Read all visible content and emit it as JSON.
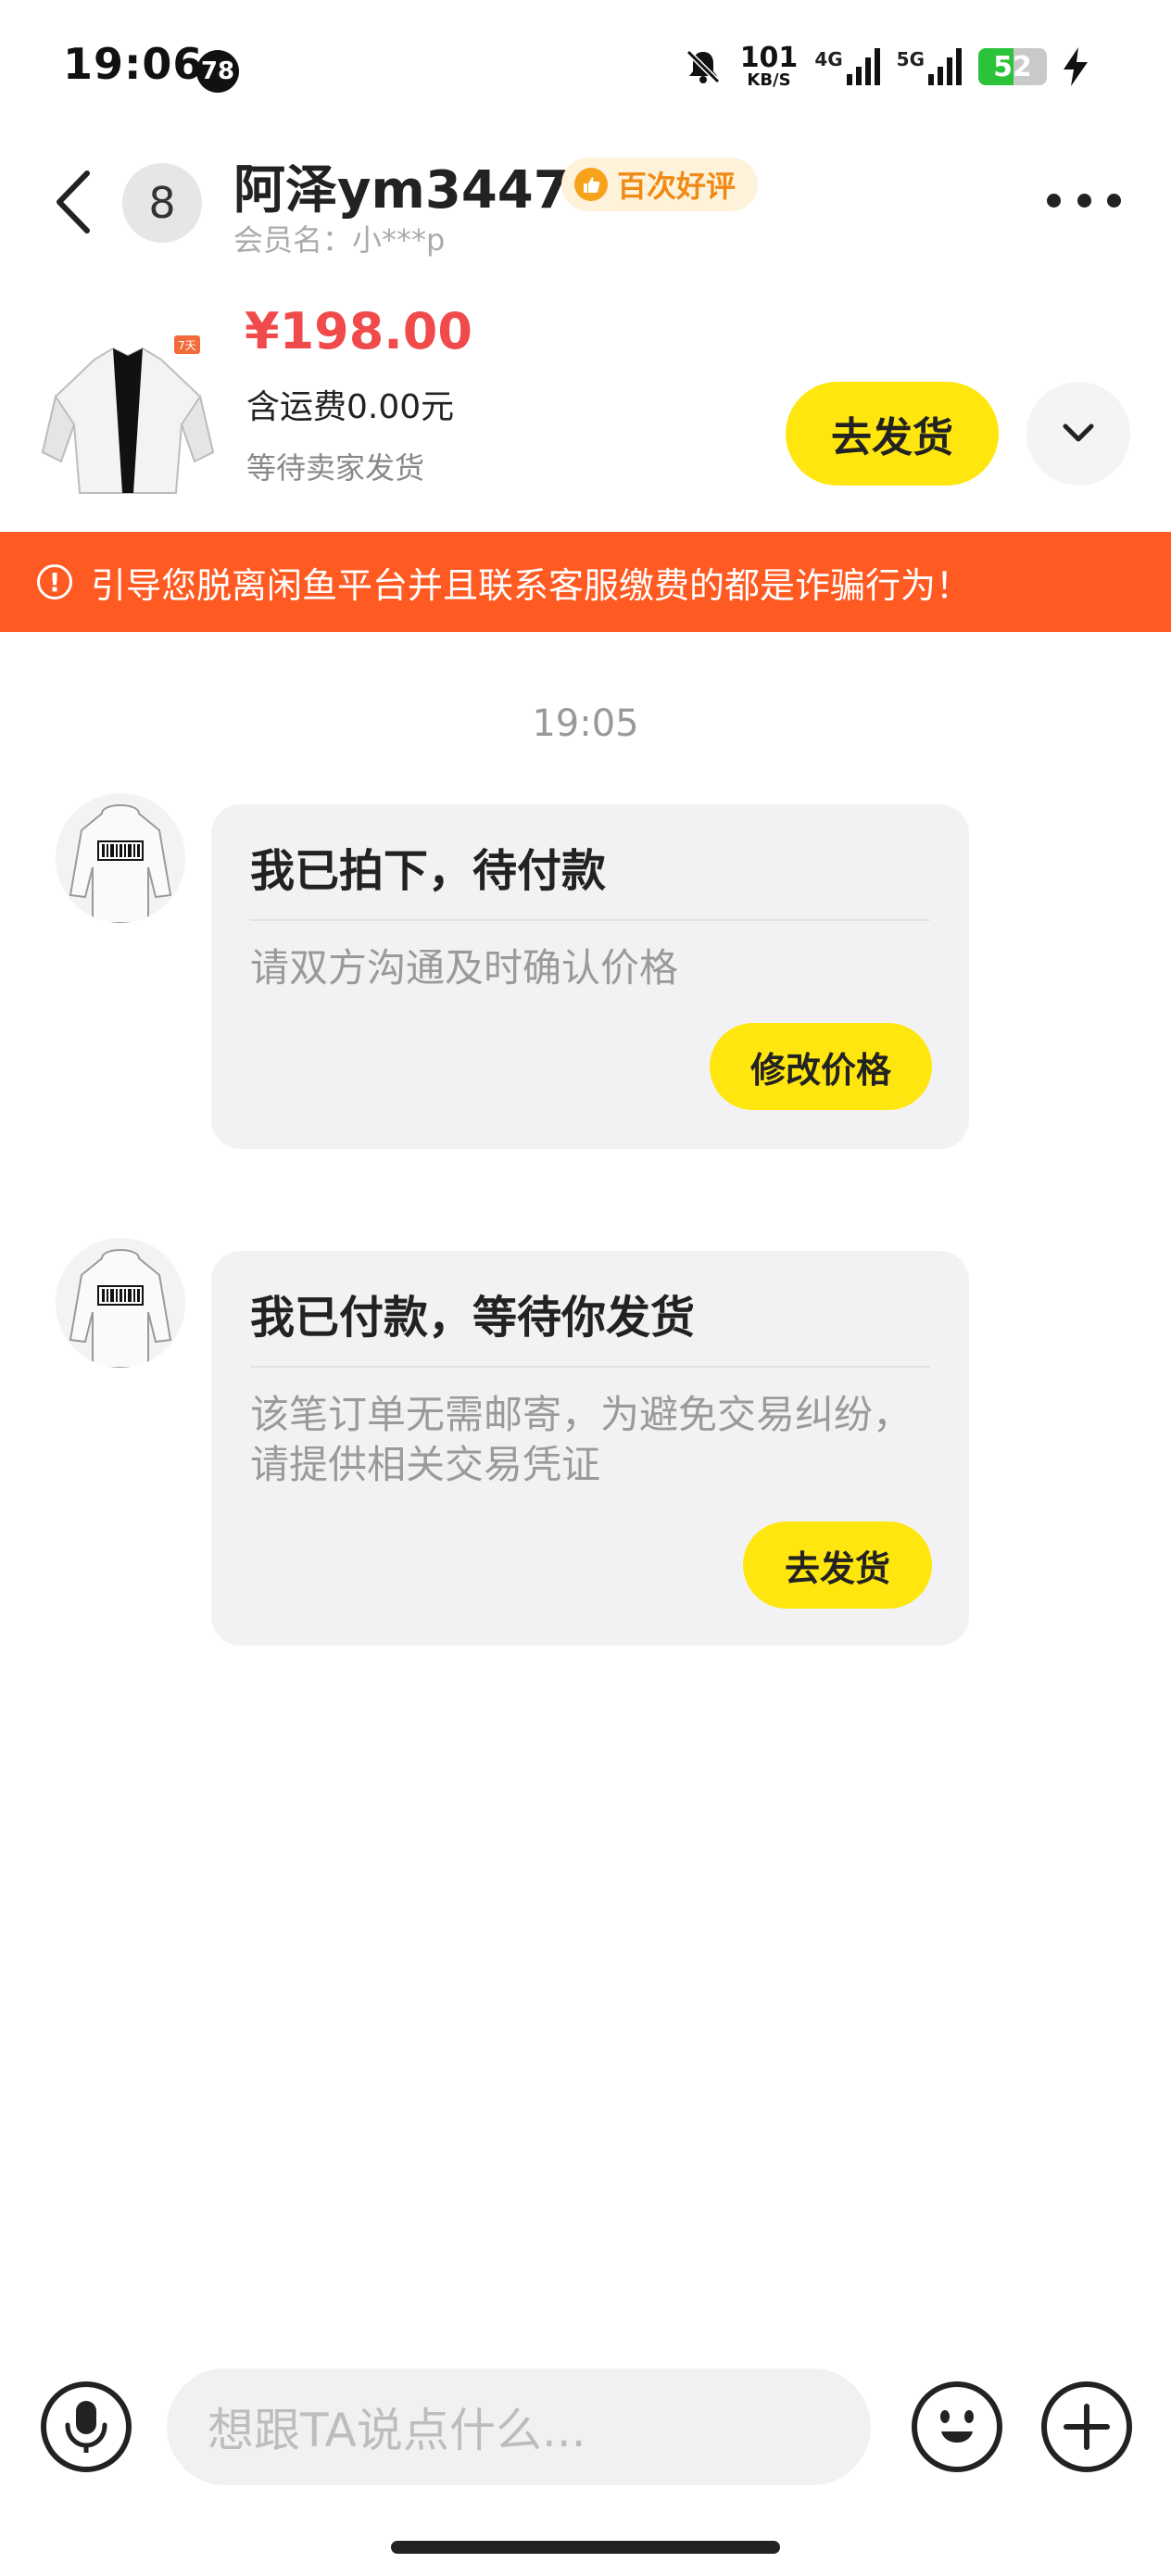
{
  "status_bar": {
    "time": "19:06",
    "notification_count": "78",
    "net_speed_value": "101",
    "net_speed_unit": "KB/S",
    "signal_1": "4G",
    "signal_2": "5G",
    "battery": "52",
    "battery_level_percent": 52
  },
  "header": {
    "unread_count": "8",
    "nickname": "阿泽ym3447",
    "badge": "百次好评",
    "member_name": "会员名：小***p"
  },
  "product": {
    "price": "¥198.00",
    "shipping": "含运费0.00元",
    "status": "等待卖家发货",
    "ship_button": "去发货",
    "tag": "7天"
  },
  "warning": {
    "text": "引导您脱离闲鱼平台并且联系客服缴费的都是诈骗行为！"
  },
  "chat": {
    "timestamp": "19:05",
    "messages": [
      {
        "title": "我已拍下，待付款",
        "desc": "请双方沟通及时确认价格",
        "button": "修改价格"
      },
      {
        "title": "我已付款，等待你发货",
        "desc": "该笔订单无需邮寄，为避免交易纠纷，请提供相关交易凭证",
        "button": "去发货"
      }
    ]
  },
  "input": {
    "placeholder": "想跟TA说点什么..."
  },
  "colors": {
    "accent_yellow": "#ffe60f",
    "price_red": "#f04a4a",
    "warning_orange": "#ff5a22",
    "badge_orange": "#ef8a14"
  }
}
